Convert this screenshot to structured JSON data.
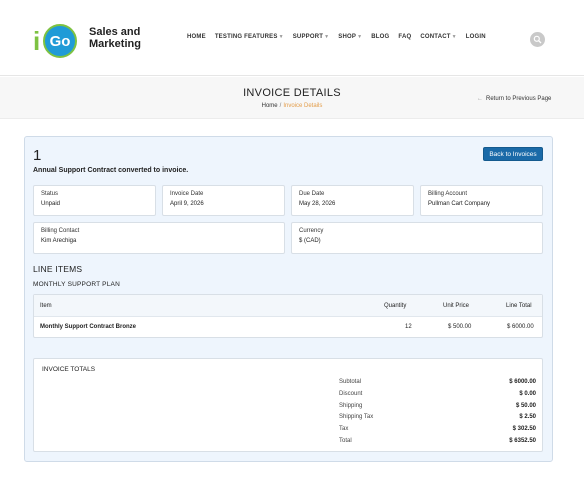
{
  "header": {
    "logo_letter": "i",
    "logo_go": "Go",
    "logo_line1": "Sales and",
    "logo_line2": "Marketing",
    "nav": [
      {
        "label": "HOME",
        "caret": false
      },
      {
        "label": "TESTING FEATURES",
        "caret": true
      },
      {
        "label": "SUPPORT",
        "caret": true
      },
      {
        "label": "SHOP",
        "caret": true
      },
      {
        "label": "BLOG",
        "caret": false
      },
      {
        "label": "FAQ",
        "caret": false
      },
      {
        "label": "CONTACT",
        "caret": true
      },
      {
        "label": "LOGIN",
        "caret": false
      }
    ],
    "search_icon": "search-icon"
  },
  "titlebar": {
    "title": "INVOICE DETAILS",
    "breadcrumb_home": "Home",
    "breadcrumb_sep": "/",
    "breadcrumb_current": "Invoice Details",
    "back_link": "Return to Previous Page"
  },
  "invoice": {
    "number": "1",
    "description": "Annual Support Contract converted to invoice.",
    "back_button": "Back to Invoices",
    "fields": {
      "status": {
        "label": "Status",
        "value": "Unpaid"
      },
      "invoice_date": {
        "label": "Invoice Date",
        "value": "April 9, 2026"
      },
      "due_date": {
        "label": "Due Date",
        "value": "May 28, 2026"
      },
      "billing_account": {
        "label": "Billing Account",
        "value": "Pullman Cart Company"
      },
      "billing_contact": {
        "label": "Billing Contact",
        "value": "Kim Arechiga"
      },
      "currency": {
        "label": "Currency",
        "value": "$ (CAD)"
      }
    }
  },
  "line_items": {
    "heading": "LINE ITEMS",
    "group": "MONTHLY SUPPORT PLAN",
    "columns": {
      "item": "Item",
      "quantity": "Quantity",
      "unit_price": "Unit Price",
      "line_total": "Line Total"
    },
    "rows": [
      {
        "item": "Monthly Support Contract Bronze",
        "quantity": "12",
        "unit_price": "$ 500.00",
        "line_total": "$ 6000.00"
      }
    ]
  },
  "totals": {
    "heading": "INVOICE TOTALS",
    "rows": [
      {
        "label": "Subtotal",
        "value": "$ 6000.00"
      },
      {
        "label": "Discount",
        "value": "$ 0.00"
      },
      {
        "label": "Shipping",
        "value": "$ 50.00"
      },
      {
        "label": "Shipping Tax",
        "value": "$ 2.50"
      },
      {
        "label": "Tax",
        "value": "$ 302.50"
      },
      {
        "label": "Total",
        "value": "$ 6352.50"
      }
    ]
  },
  "colors": {
    "accent": "#1a6aa8",
    "breadcrumb_current": "#e39d4a",
    "panel_bg": "#eef5fd",
    "logo_green": "#7dc242",
    "logo_blue": "#1f9bd7"
  }
}
